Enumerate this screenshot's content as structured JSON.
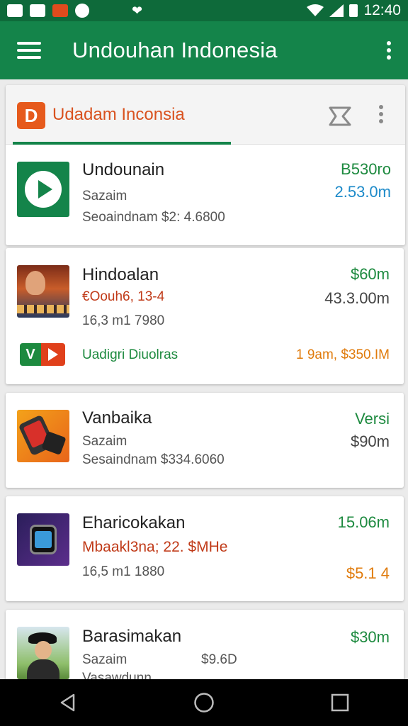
{
  "status_bar": {
    "time": "12:40",
    "icon_label": "❤"
  },
  "app_bar": {
    "title": "Undouhan Indonesia"
  },
  "tab_strip": {
    "brand_logo_letter": "D",
    "brand_name": "Udadam Inconsia"
  },
  "featured": {
    "title": "Undounain",
    "line1": "Sazaim",
    "line2": "Seoaindnam $2: 4.6800",
    "price_top": "B530ro",
    "price_bottom": "2.53.0m"
  },
  "items": [
    {
      "title": "Hindoalan",
      "line1": "€Oouh6, 13-4",
      "line2": "16,3 m1 7980",
      "price_top": "$60m",
      "price_bottom": "43.3.00m",
      "badge_letter": "V",
      "footer_label": "Uadigri Diuolras",
      "footer_price": "1 9am, $350.IM"
    },
    {
      "title": "Vanbaika",
      "line1": "Sazaim",
      "line2": "Sesaindnam $334.6060",
      "price_top": "Versi",
      "price_bottom": "$90m"
    },
    {
      "title": "Eharicokakan",
      "line1": "Mbaakl3na; 22. $MHe",
      "line2": "16,5 m1 1880",
      "price_top": "15.06m",
      "price_bottom": "$5.1 4"
    },
    {
      "title": "Barasimakan",
      "line1": "Sazaim",
      "line1_price": "$9.6D",
      "line2": "Vasawdunn",
      "price_top": "$30m"
    }
  ],
  "colors": {
    "primary": "#14844a",
    "status": "#0e6a3a",
    "accent": "#e65a1c"
  },
  "icons": [
    "menu-icon",
    "more-vert-icon",
    "pin-icon",
    "play-icon",
    "back-icon",
    "home-icon",
    "recents-icon",
    "wifi-icon",
    "signal-icon",
    "battery-icon"
  ]
}
